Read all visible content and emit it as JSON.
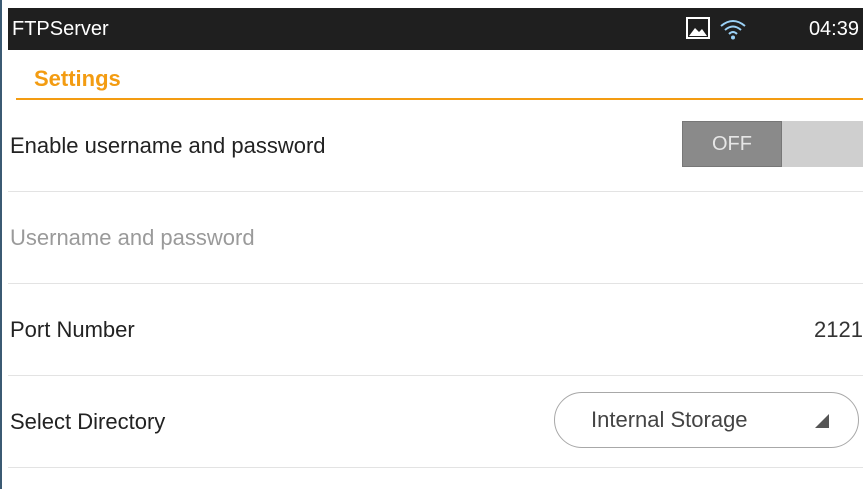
{
  "statusbar": {
    "app_title": "FTPServer",
    "time": "04:39",
    "icons": [
      "gallery-icon",
      "wifi-icon"
    ]
  },
  "settings": {
    "section_title": "Settings"
  },
  "rows": {
    "enable_auth": {
      "label": "Enable username and password",
      "toggle_state": "OFF"
    },
    "credentials": {
      "label": "Username and password"
    },
    "port": {
      "label": "Port Number",
      "value": "2121"
    },
    "directory": {
      "label": "Select Directory",
      "selected": "Internal Storage"
    }
  },
  "colors": {
    "accent": "#f39c12",
    "statusbar_bg": "#1f1f1f",
    "toggle_off": "#8a8a8a"
  }
}
